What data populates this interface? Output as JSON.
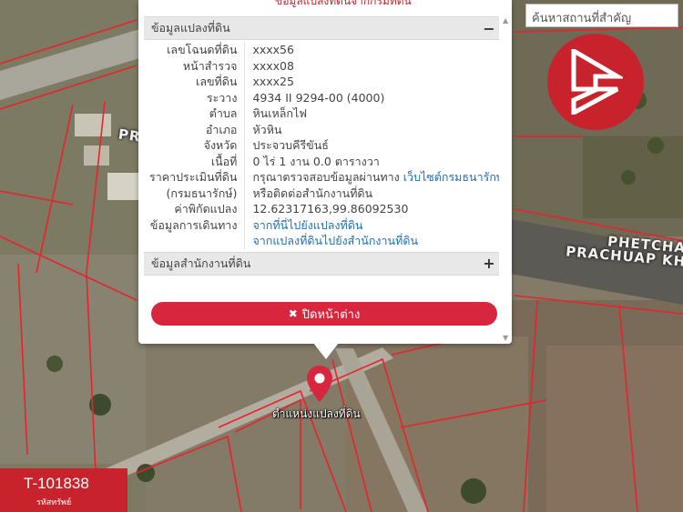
{
  "search": {
    "placeholder": "ค้นหาสถานที่สำคัญ"
  },
  "popup": {
    "top_text": "ข้อมูลแปลงที่ดินจากกรมที่ดิน",
    "section_land": {
      "title": "ข้อมูลแปลงที่ดิน",
      "toggle": "−"
    },
    "rows": [
      {
        "label": "เลขโฉนดที่ดิน",
        "value": "xxxx56"
      },
      {
        "label": "หน้าสำรวจ",
        "value": "xxxx08"
      },
      {
        "label": "เลขที่ดิน",
        "value": "xxxx25"
      },
      {
        "label": "ระวาง",
        "value": "4934 II 9294-00 (4000)"
      },
      {
        "label": "ตำบล",
        "value": "หินเหล็กไฟ"
      },
      {
        "label": "อำเภอ",
        "value": "หัวหิน"
      },
      {
        "label": "จังหวัด",
        "value": "ประจวบคีรีขันธ์"
      },
      {
        "label": "เนื้อที่",
        "value": "0 ไร่ 1 งาน 0.0 ตารางวา"
      }
    ],
    "price": {
      "label1": "ราคาประเมินที่ดิน",
      "label2": "(กรมธนารักษ์)",
      "value1": "กรุณาตรวจสอบข้อมูลผ่านทาง",
      "value1_link": "เว็บไซต์กรมธนารักษ์",
      "value2": "หรือติดต่อสำนักงานที่ดิน"
    },
    "coords": {
      "label": "ค่าพิกัดแปลง",
      "value": "12.62317163,99.86092530"
    },
    "travel": {
      "label": "ข้อมูลการเดินทาง",
      "link1": "จากที่นี่ไปยังแปลงที่ดิน",
      "link2": "จากแปลงที่ดินไปยังสำนักงานที่ดิน"
    },
    "section_office": {
      "title": "ข้อมูลสำนักงานที่ดิน",
      "toggle": "+"
    },
    "close_label": "ปิดหน้าต่าง"
  },
  "map": {
    "pin_label": "ตำแหน่งแปลงที่ดิน",
    "road_labels": [
      "PR",
      "PHETCHA",
      "PRACHUAP KH"
    ]
  },
  "badge": {
    "code": "T-101838",
    "sub": "รหัสทรัพย์"
  },
  "colors": {
    "brand_red": "#c8232c",
    "close_button": "#d7263d",
    "link_blue": "#1f6fb4",
    "parcel_outline": "#e8232c"
  },
  "icons": {
    "logo": "brand-b-logo-icon",
    "pin": "map-pin-icon",
    "close": "close-x-icon"
  }
}
